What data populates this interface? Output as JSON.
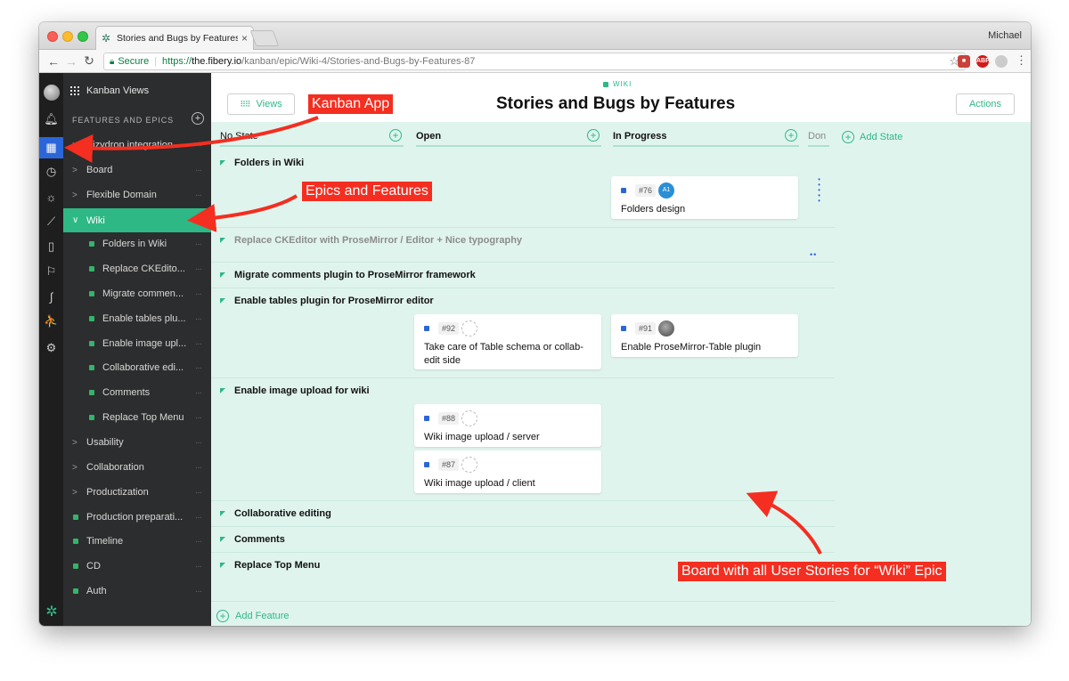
{
  "browser": {
    "tab_title": "Stories and Bugs by Features",
    "user": "Michael",
    "secure_label": "Secure",
    "url_proto": "https://",
    "url_host": "the.fibery.io",
    "url_path": "/kanban/epic/Wiki-4/Stories-and-Bugs-by-Features-87"
  },
  "sidebar": {
    "header": "Kanban Views",
    "section": "FEATURES AND EPICS",
    "items": [
      {
        "label": "Vizydrop integration",
        "type": "epic"
      },
      {
        "label": "Board",
        "type": "epic"
      },
      {
        "label": "Flexible Domain",
        "type": "epic"
      },
      {
        "label": "Wiki",
        "type": "epic-open"
      },
      {
        "label": "Folders in Wiki",
        "type": "feature"
      },
      {
        "label": "Replace CKEdito...",
        "type": "feature"
      },
      {
        "label": "Migrate commen...",
        "type": "feature"
      },
      {
        "label": "Enable tables plu...",
        "type": "feature"
      },
      {
        "label": "Enable image upl...",
        "type": "feature"
      },
      {
        "label": "Collaborative edi...",
        "type": "feature"
      },
      {
        "label": "Comments",
        "type": "feature"
      },
      {
        "label": "Replace Top Menu",
        "type": "feature"
      },
      {
        "label": "Usability",
        "type": "epic"
      },
      {
        "label": "Collaboration",
        "type": "epic"
      },
      {
        "label": "Productization",
        "type": "epic"
      },
      {
        "label": "Production preparati...",
        "type": "top-feature"
      },
      {
        "label": "Timeline",
        "type": "top-feature"
      },
      {
        "label": "CD",
        "type": "top-feature"
      },
      {
        "label": "Auth",
        "type": "top-feature"
      }
    ]
  },
  "main": {
    "views_label": "Views",
    "entity_tag": "WIKI",
    "title": "Stories and Bugs by Features",
    "actions_label": "Actions"
  },
  "board": {
    "columns": [
      "No State",
      "Open",
      "In Progress",
      "Don"
    ],
    "add_state": "Add State",
    "add_feature": "Add Feature",
    "features": [
      {
        "name": "Folders in Wiki"
      },
      {
        "name": "Replace CKEditor with ProseMirror / Editor + Nice typography"
      },
      {
        "name": "Migrate comments plugin to ProseMirror framework"
      },
      {
        "name": "Enable tables plugin for ProseMirror editor"
      },
      {
        "name": "Enable image upload for wiki"
      },
      {
        "name": "Collaborative editing"
      },
      {
        "name": "Comments"
      },
      {
        "name": "Replace Top Menu"
      }
    ],
    "cards": [
      {
        "id": "#76",
        "title": "Folders design",
        "avatar": "A1"
      },
      {
        "id": "#92",
        "title": "Take care of Table schema or collab-edit side"
      },
      {
        "id": "#91",
        "title": "Enable ProseMirror-Table plugin"
      },
      {
        "id": "#88",
        "title": "Wiki image upload / server"
      },
      {
        "id": "#87",
        "title": "Wiki image upload / client"
      }
    ]
  },
  "annotations": {
    "kanban_app": "Kanban App",
    "epics_features": "Epics and Features",
    "board_note": "Board with all User Stories for “Wiki” Epic"
  }
}
